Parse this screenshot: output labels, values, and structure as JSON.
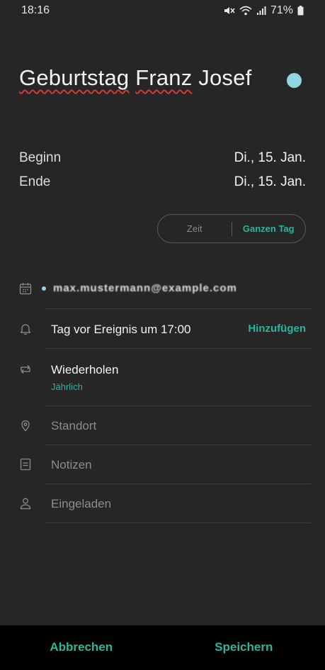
{
  "status_bar": {
    "time": "18:16",
    "battery_percent": "71%",
    "icons": [
      "mute-icon",
      "wifi-icon",
      "signal-icon",
      "battery-icon"
    ]
  },
  "event": {
    "title_part1": "Geburtstag",
    "title_part2": "Franz",
    "title_part3": "Josef",
    "color": "#8fd6e1"
  },
  "dates": {
    "begin_label": "Beginn",
    "begin_value": "Di., 15. Jan.",
    "end_label": "Ende",
    "end_value": "Di., 15. Jan."
  },
  "time_toggle": {
    "option_time": "Zeit",
    "option_allday": "Ganzen Tag",
    "selected": "Ganzen Tag"
  },
  "calendar": {
    "account": "max.mustermann@example.com"
  },
  "reminder": {
    "text": "Tag vor Ereignis um 17:00",
    "add_label": "Hinzufügen"
  },
  "repeat": {
    "title": "Wiederholen",
    "value": "Jährlich"
  },
  "fields": {
    "location_placeholder": "Standort",
    "notes_placeholder": "Notizen",
    "invited_placeholder": "Eingeladen"
  },
  "actions": {
    "cancel": "Abbrechen",
    "save": "Speichern"
  },
  "colors": {
    "accent": "#2cb59a",
    "background": "#262626",
    "bottom_bar": "#000000"
  }
}
